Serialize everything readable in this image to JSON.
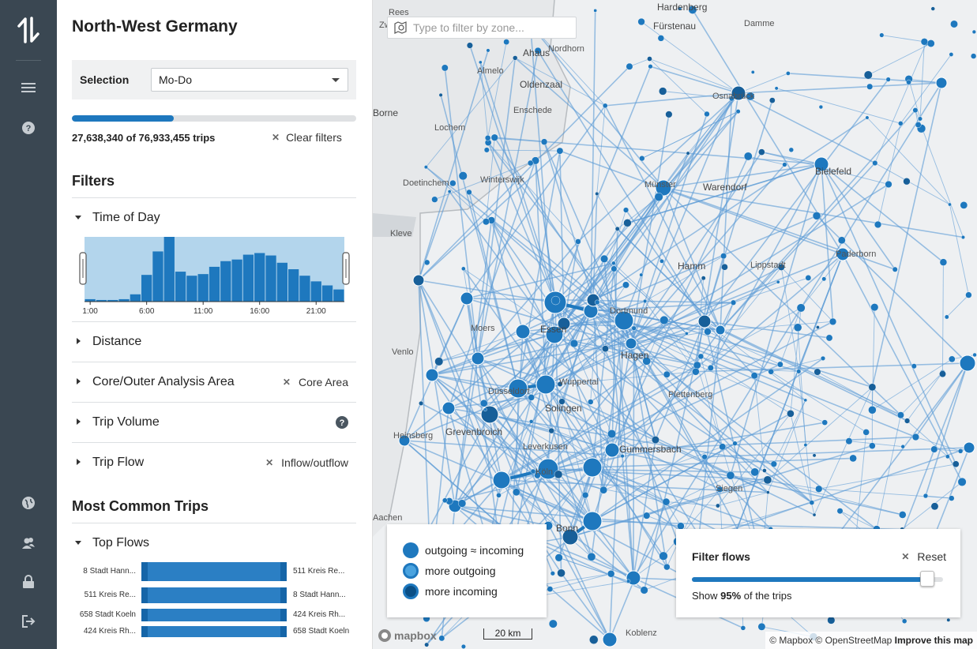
{
  "app": {
    "title": "North-West Germany"
  },
  "rail": {
    "icons": [
      "logo-icon",
      "menu-icon",
      "help-icon",
      "globe-icon",
      "users-icon",
      "lock-icon",
      "logout-icon"
    ]
  },
  "selection": {
    "label": "Selection",
    "value": "Mo-Do"
  },
  "trips": {
    "summary": "27,638,340 of 76,933,455 trips",
    "fraction": 0.359,
    "clear_label": "Clear filters"
  },
  "filters": {
    "heading": "Filters",
    "time_of_day": {
      "label": "Time of Day",
      "ticks": [
        "1:00",
        "6:00",
        "11:00",
        "16:00",
        "21:00"
      ],
      "values": [
        3,
        2,
        2,
        3,
        9,
        33,
        62,
        80,
        37,
        32,
        34,
        43,
        50,
        52,
        58,
        60,
        57,
        48,
        40,
        32,
        25,
        20,
        15
      ]
    },
    "distance": {
      "label": "Distance"
    },
    "core_outer": {
      "label": "Core/Outer Analysis Area",
      "value": "Core Area"
    },
    "trip_volume": {
      "label": "Trip Volume"
    },
    "trip_flow": {
      "label": "Trip Flow",
      "value": "Inflow/outflow"
    }
  },
  "most_common": {
    "heading": "Most Common Trips",
    "top_flows": {
      "label": "Top Flows",
      "rows": [
        {
          "from": "8 Stadt Hann...",
          "to": "511 Kreis Re..."
        },
        {
          "from": "511 Kreis Re...",
          "to": "8 Stadt Hann..."
        },
        {
          "from": "658 Stadt Koeln",
          "to": "424 Kreis Rh..."
        },
        {
          "from": "424 Kreis Rh...",
          "to": "658 Stadt Koeln"
        }
      ]
    }
  },
  "map": {
    "search_placeholder": "Type to filter by zone...",
    "labels": [
      "Hardenberg",
      "Zwolle",
      "Nordhorn",
      "Fürstenau",
      "Damme",
      "Almelo",
      "Oldenzaal",
      "Enschede",
      "Osnabrück",
      "Borne",
      "Lochem",
      "Münster",
      "Bielefeld",
      "Doetinchem",
      "Winterswijk",
      "Warendorf",
      "Paderborn",
      "Kleve",
      "Hamm",
      "Lippstadt",
      "Moers",
      "Essen",
      "Dortmund",
      "Venlo",
      "Hagen",
      "Düsseldorf",
      "Wuppertal",
      "Solingen",
      "Leverkusen",
      "Köln",
      "Gummersbach",
      "Siegen",
      "Aachen",
      "Bonn",
      "Koblenz",
      "Heinsberg",
      "Grevenbroich",
      "Plettenberg",
      "Rees",
      "Ahaus"
    ],
    "legend": [
      {
        "label": "outgoing ≈ incoming",
        "color": "#1e78be"
      },
      {
        "label": "more outgoing",
        "color": "#4aa3df"
      },
      {
        "label": "more incoming",
        "color": "#0a4f86"
      }
    ],
    "filter_flows": {
      "title": "Filter flows",
      "reset_label": "Reset",
      "show_prefix": "Show ",
      "show_value": "95%",
      "show_suffix": " of the trips",
      "fraction": 0.95
    },
    "mapbox_label": "mapbox",
    "scale_label": "20 km",
    "attribution": "© Mapbox © OpenStreetMap",
    "improve_label": "Improve this map"
  },
  "colors": {
    "accent": "#1e78be",
    "rail": "#3a4752",
    "flow": "#5b9bd5"
  }
}
